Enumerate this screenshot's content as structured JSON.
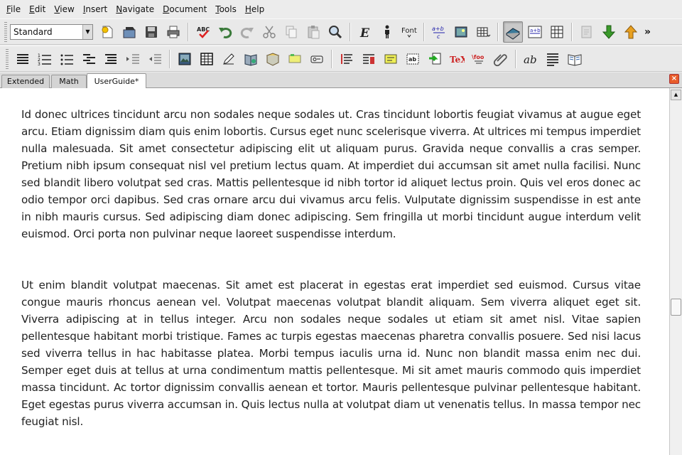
{
  "menu": [
    "File",
    "Edit",
    "View",
    "Insert",
    "Navigate",
    "Document",
    "Tools",
    "Help"
  ],
  "toolbar": {
    "layout_value": "Standard",
    "font_label": "Font",
    "more_glyph": "»",
    "tex_label": "TeX",
    "foo_label": "\\foo",
    "ab_label": "ab",
    "abc_label": "ABC"
  },
  "tabs": [
    "Extended",
    "Math",
    "UserGuide*"
  ],
  "active_tab": "UserGuide*",
  "document": {
    "paragraph1": "Id donec ultrices tincidunt arcu non sodales neque sodales ut. Cras tincidunt lobortis feugiat vivamus at augue eget arcu. Etiam dignissim diam quis enim lobortis. Cursus eget nunc scelerisque viverra. At ultrices mi tempus imperdiet nulla malesuada. Sit amet consectetur adipiscing elit ut aliquam purus. Gravida neque convallis a cras semper. Pretium nibh ipsum consequat nisl vel pretium lectus quam. At imperdiet dui accumsan sit amet nulla facilisi. Nunc sed blandit libero volutpat sed cras. Mattis pellentesque id nibh tortor id aliquet lectus proin. Quis vel eros donec ac odio tempor orci dapibus. Sed cras ornare arcu dui vivamus arcu felis. Vulputate dignissim suspendisse in est ante in nibh mauris cursus. Sed adipiscing diam donec adipiscing. Sem fringilla ut morbi tincidunt augue interdum velit euismod. Orci porta non pulvinar neque laoreet suspendisse interdum.",
    "paragraph2": "Ut enim blandit volutpat maecenas. Sit amet est placerat in egestas erat imperdiet sed euismod. Cursus vitae congue mauris rhoncus aenean vel. Volutpat maecenas volutpat blandit aliquam. Sem viverra aliquet eget sit. Viverra adipiscing at in tellus integer. Arcu non sodales neque sodales ut etiam sit amet nisl. Vitae sapien pellentesque habitant morbi tristique. Fames ac turpis egestas maecenas pharetra convallis posuere. Sed nisi lacus sed viverra tellus in hac habitasse platea. Morbi tempus iaculis urna id. Nunc non blandit massa enim nec dui. Semper eget duis at tellus at urna condimentum mattis pellentesque. Mi sit amet mauris commodo quis imperdiet massa tincidunt. Ac tortor dignissim convallis aenean et tortor. Mauris pellentesque pulvinar pellentesque habitant. Eget egestas purus viverra accumsan in. Quis lectus nulla at volutpat diam ut venenatis tellus. In massa tempor nec feugiat nisl."
  },
  "colors": {
    "accent_green": "#3a9a2a",
    "accent_orange": "#e8a020",
    "close_red": "#e85c2a"
  }
}
